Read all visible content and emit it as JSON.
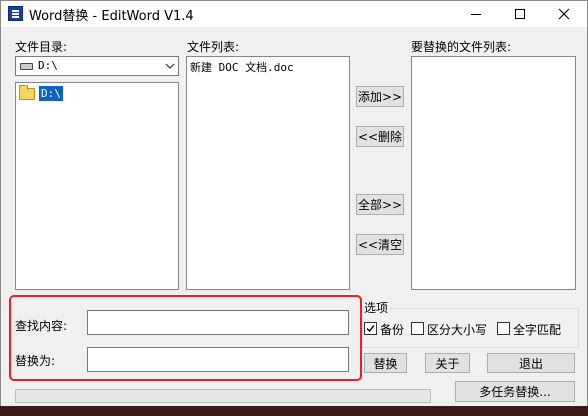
{
  "window": {
    "title": "Word替换 - EditWord V1.4"
  },
  "labels": {
    "dir": "文件目录:",
    "file_list": "文件列表:",
    "replace_list": "要替换的文件列表:",
    "options": "选项",
    "find": "查找内容:",
    "replace": "替换为:"
  },
  "drive": {
    "value": "D:\\"
  },
  "tree": {
    "item": "D:\\"
  },
  "files": [
    "新建 DOC 文档.doc"
  ],
  "buttons": {
    "add": "添加>>",
    "remove": "<<删除",
    "all": "全部>>",
    "clear": "<<清空",
    "replace": "替换",
    "about": "关于",
    "exit": "退出",
    "multi": "多任务替换..."
  },
  "options": {
    "backup": {
      "label": "备份",
      "checked": true
    },
    "case": {
      "label": "区分大小写",
      "checked": false
    },
    "whole": {
      "label": "全字匹配",
      "checked": false
    }
  },
  "inputs": {
    "find_value": "",
    "replace_value": ""
  },
  "colors": {
    "highlight": "#e8202a",
    "selection": "#0a64c8"
  }
}
